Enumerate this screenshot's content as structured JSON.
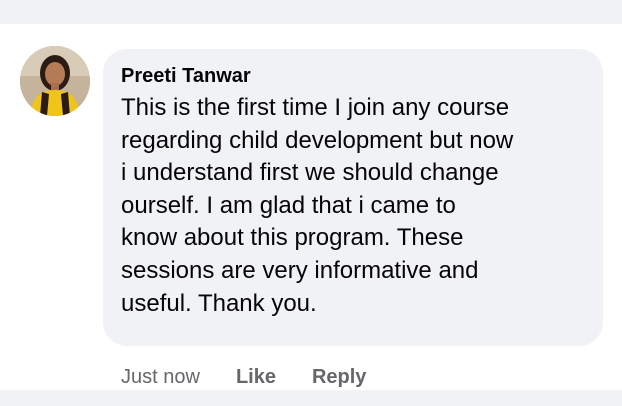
{
  "comment": {
    "author": "Preeti Tanwar",
    "text": "This is the first time I join any course\nregarding child development but now\ni understand first we should change\nourself. I am glad that i came to\nknow about this program. These\nsessions are very informative and\nuseful. Thank you.",
    "timestamp": "Just now"
  },
  "actions": {
    "like_label": "Like",
    "reply_label": "Reply"
  },
  "colors": {
    "bubble_background": "#f0f2f5",
    "text": "#050505",
    "meta_text": "#65676b"
  },
  "icons": {
    "avatar": "profile-photo"
  }
}
